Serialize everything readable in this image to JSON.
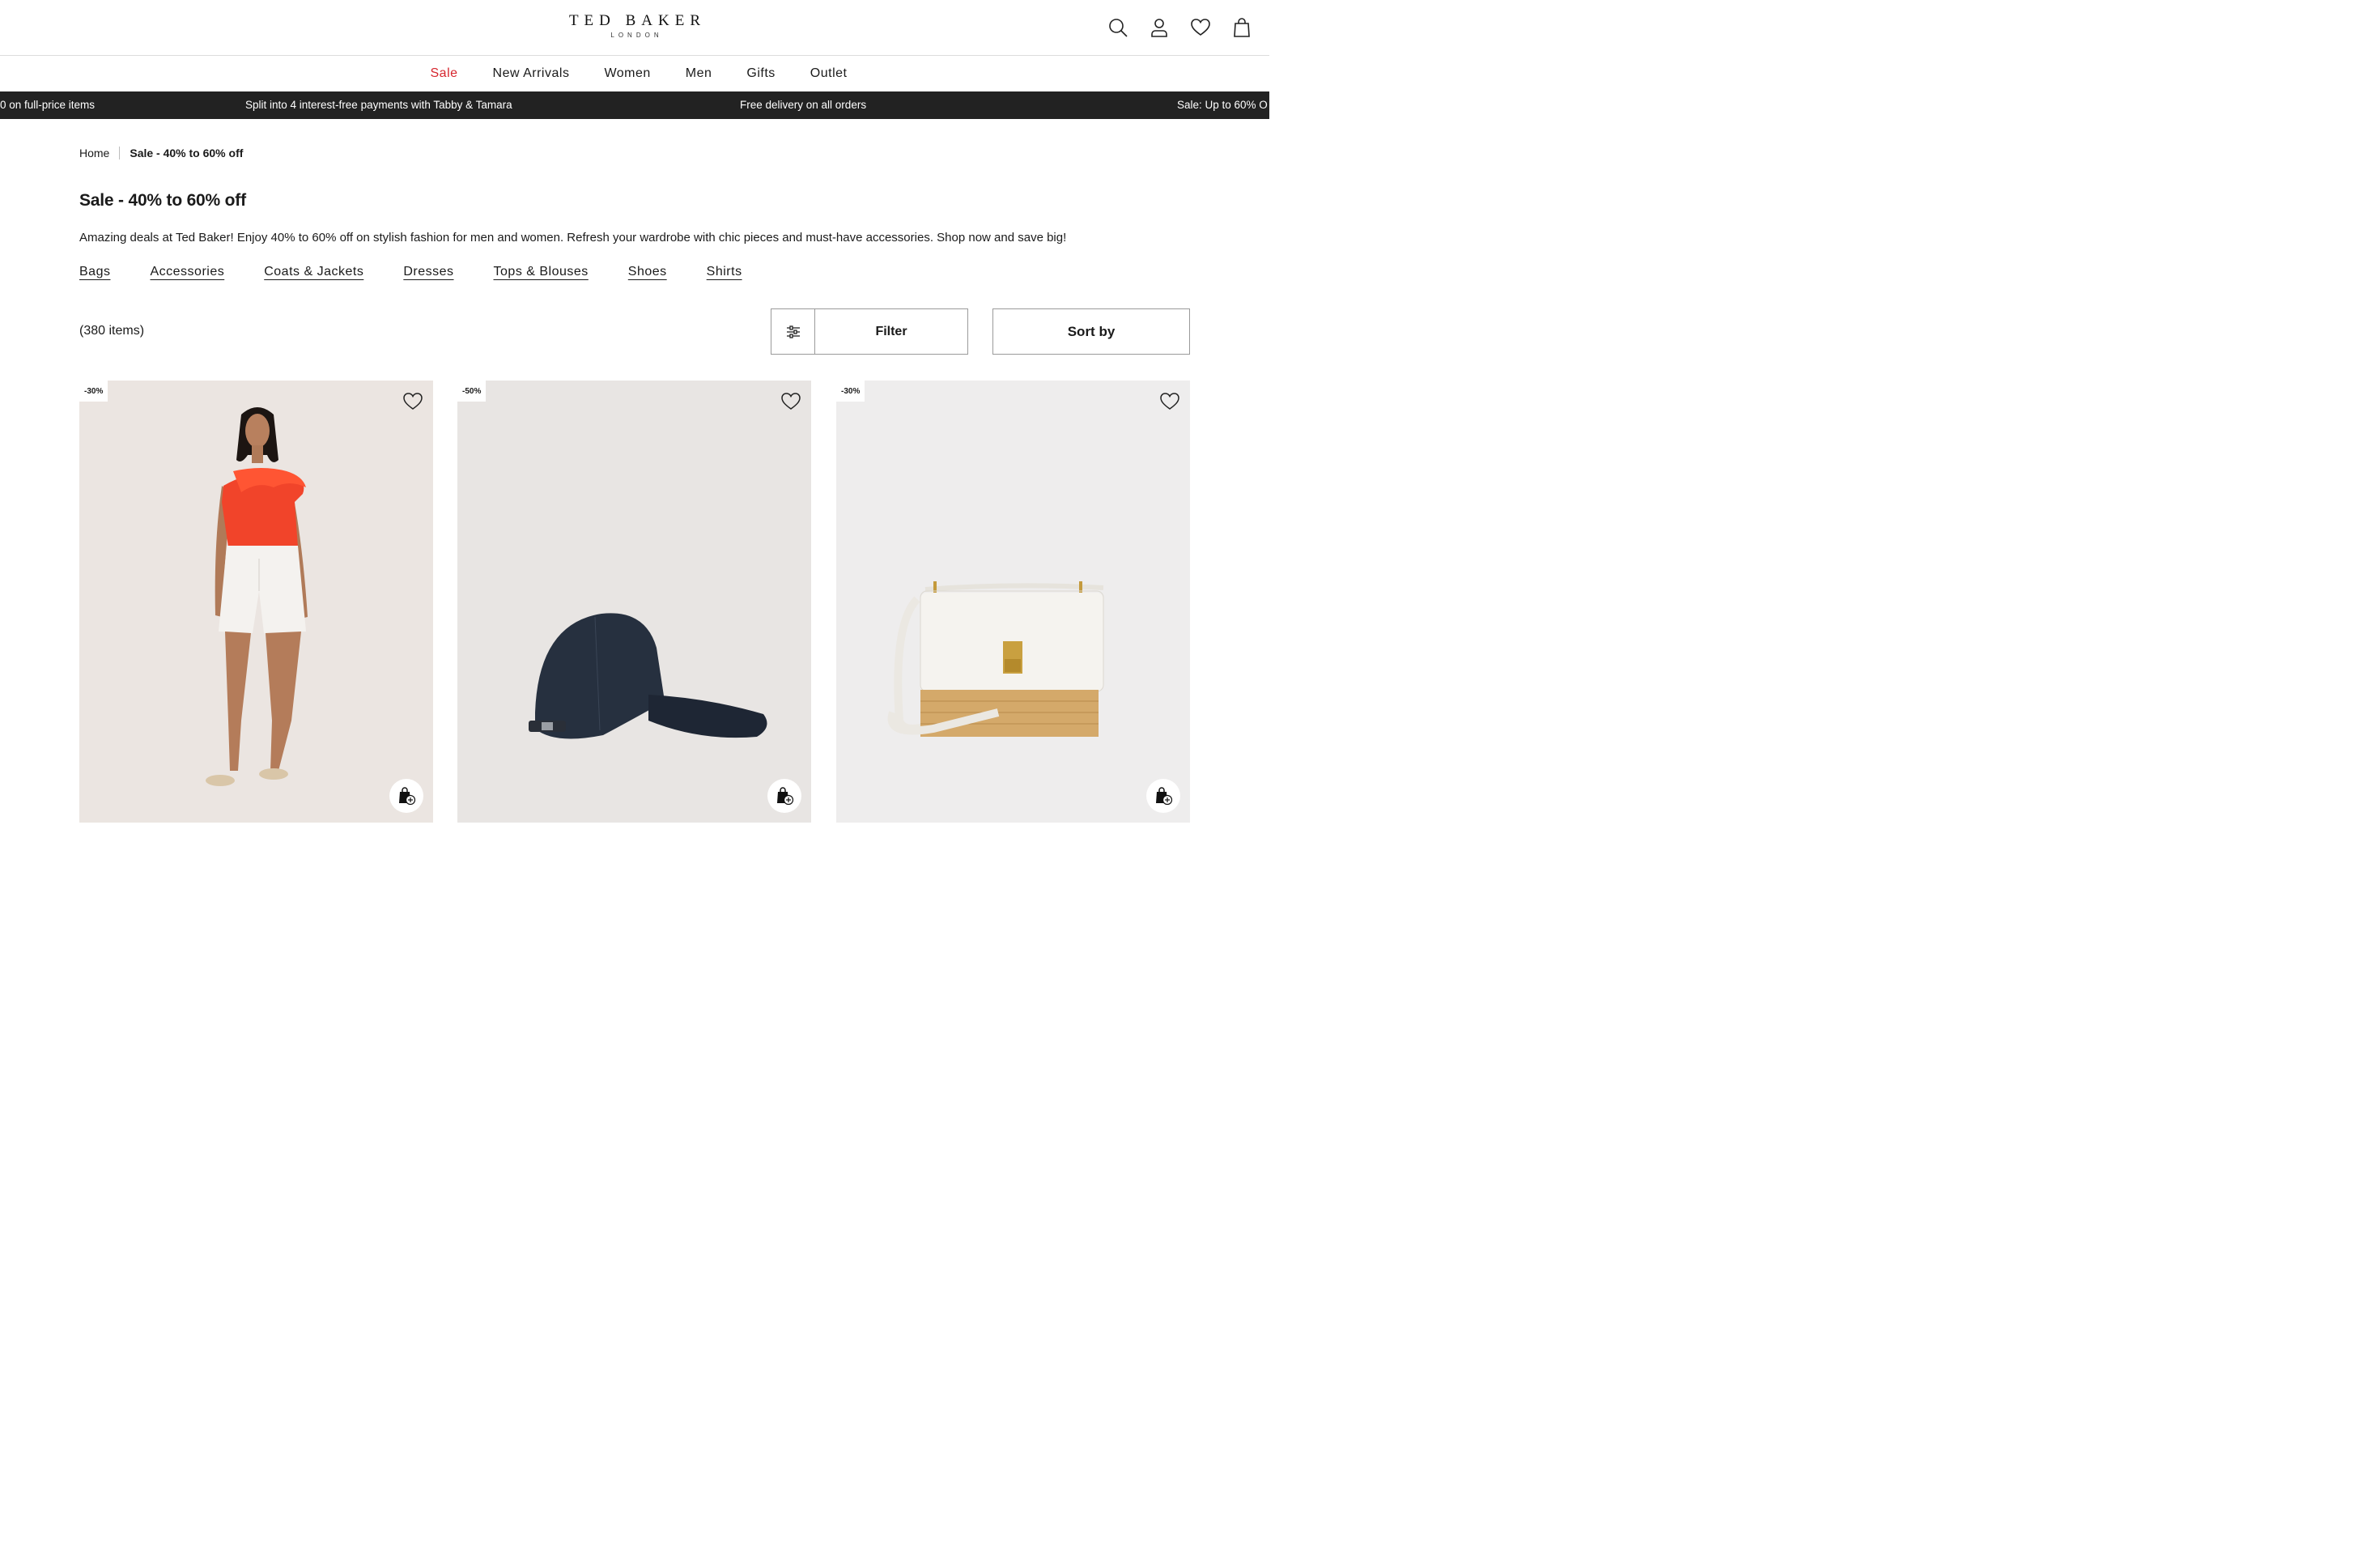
{
  "brand": {
    "name": "TED BAKER",
    "sub": "LONDON"
  },
  "header_icons": [
    "search-icon",
    "account-icon",
    "wishlist-icon",
    "bag-icon"
  ],
  "nav": {
    "items": [
      {
        "label": "Sale",
        "highlight": true
      },
      {
        "label": "New Arrivals"
      },
      {
        "label": "Women"
      },
      {
        "label": "Men"
      },
      {
        "label": "Gifts"
      },
      {
        "label": "Outlet"
      }
    ]
  },
  "promo": {
    "messages": [
      "0 on full-price items",
      "Split into 4 interest-free payments with Tabby & Tamara",
      "Free delivery on all orders",
      "Sale: Up to 60% O"
    ]
  },
  "breadcrumb": {
    "home": "Home",
    "current": "Sale - 40% to 60% off"
  },
  "page": {
    "title": "Sale - 40% to 60% off",
    "description": "Amazing deals at Ted Baker! Enjoy  40% to 60% off on stylish fashion for men and women. Refresh your wardrobe with chic pieces and must-have accessories. Shop now and save big!",
    "categories": [
      "Bags",
      "Accessories",
      "Coats & Jackets",
      "Dresses",
      "Tops & Blouses",
      "Shoes",
      "Shirts"
    ],
    "item_count": "(380 items)"
  },
  "toolbar": {
    "filter_label": "Filter",
    "sort_label": "Sort by"
  },
  "products": [
    {
      "badge": "-30%",
      "image": "model in red one-shoulder ruffle top and white shorts"
    },
    {
      "badge": "-50%",
      "image": "navy denim baseball cap"
    },
    {
      "badge": "-30%",
      "image": "white and rattan crossbody bag"
    }
  ],
  "colors": {
    "sale_red": "#d6262e",
    "promo_bg": "#222222"
  }
}
